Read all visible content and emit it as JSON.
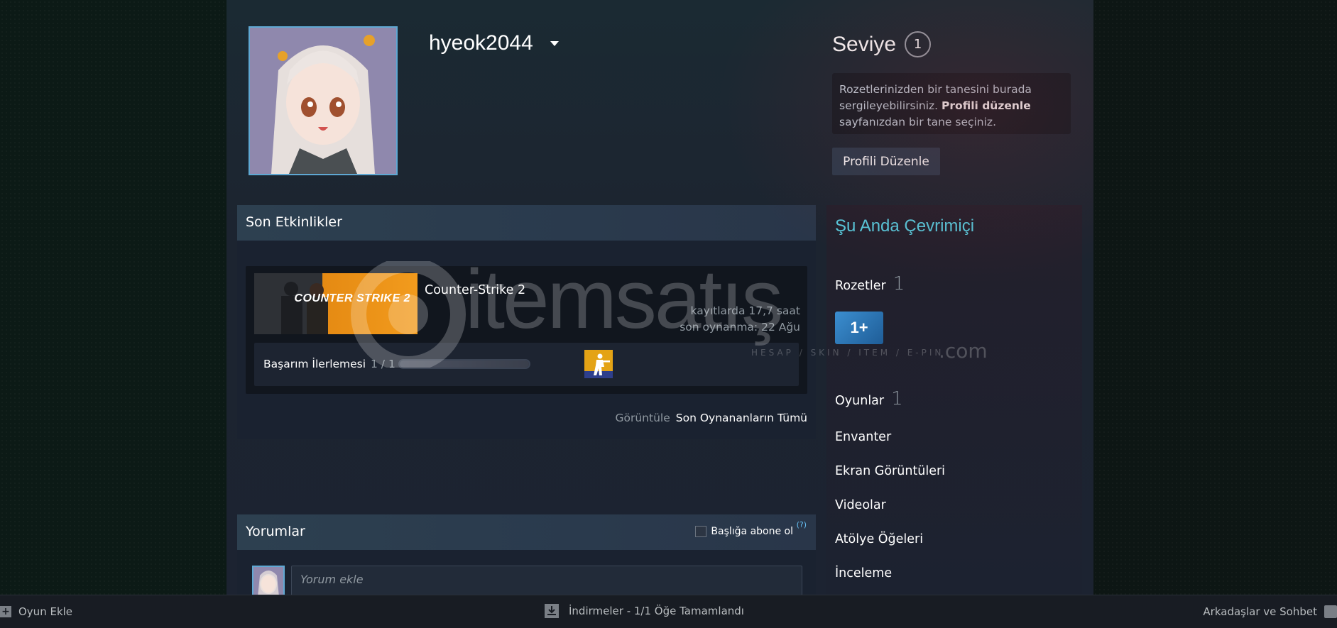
{
  "profile": {
    "username": "hyeok2044",
    "level_label": "Seviye",
    "level_value": "1",
    "badge_info_part1": "Rozetlerinizden bir tanesini burada sergileyebilirsiniz. ",
    "badge_info_link": "Profili düzenle",
    "badge_info_part2": " sayfanızdan bir tane seçiniz.",
    "edit_button": "Profili Düzenle"
  },
  "recent_activity": {
    "title": "Son Etkinlikler",
    "game": {
      "name": "Counter-Strike 2",
      "capsule_text": "COUNTER STRIKE 2",
      "hours": "kayıtlarda 17,7 saat",
      "last_played": "son oynanma: 22 Ağu",
      "achievement_label": "Başarım İlerlemesi",
      "achievement_count": "1 / 1",
      "achievement_progress": 1.0
    },
    "view_label": "Görüntüle",
    "view_link": "Son Oynananların Tümü"
  },
  "comments": {
    "title": "Yorumlar",
    "subscribe_label": "Başlığa abone ol",
    "help": "(?)",
    "input_placeholder": "Yorum ekle"
  },
  "sidebar": {
    "online_status": "Şu Anda Çevrimiçi",
    "badges_label": "Rozetler",
    "badges_count": "1",
    "badge_thumb": "1+",
    "games_label": "Oyunlar",
    "games_count": "1",
    "inventory": "Envanter",
    "screenshots": "Ekran Görüntüleri",
    "videos": "Videolar",
    "workshop": "Atölye Öğeleri",
    "reviews": "İnceleme"
  },
  "watermark": {
    "text": "itemsatış",
    "sub": "HESAP / SKIN / ITEM / E-PIN",
    "domain": ".com"
  },
  "bottom_bar": {
    "add_game": "Oyun Ekle",
    "downloads": "İndirmeler - 1/1 Öğe Tamamlandı",
    "friends": "Arkadaşlar ve Sohbet"
  },
  "colors": {
    "accent": "#57cbde",
    "link": "#66c0f4",
    "page_bg": "#1c2331"
  }
}
